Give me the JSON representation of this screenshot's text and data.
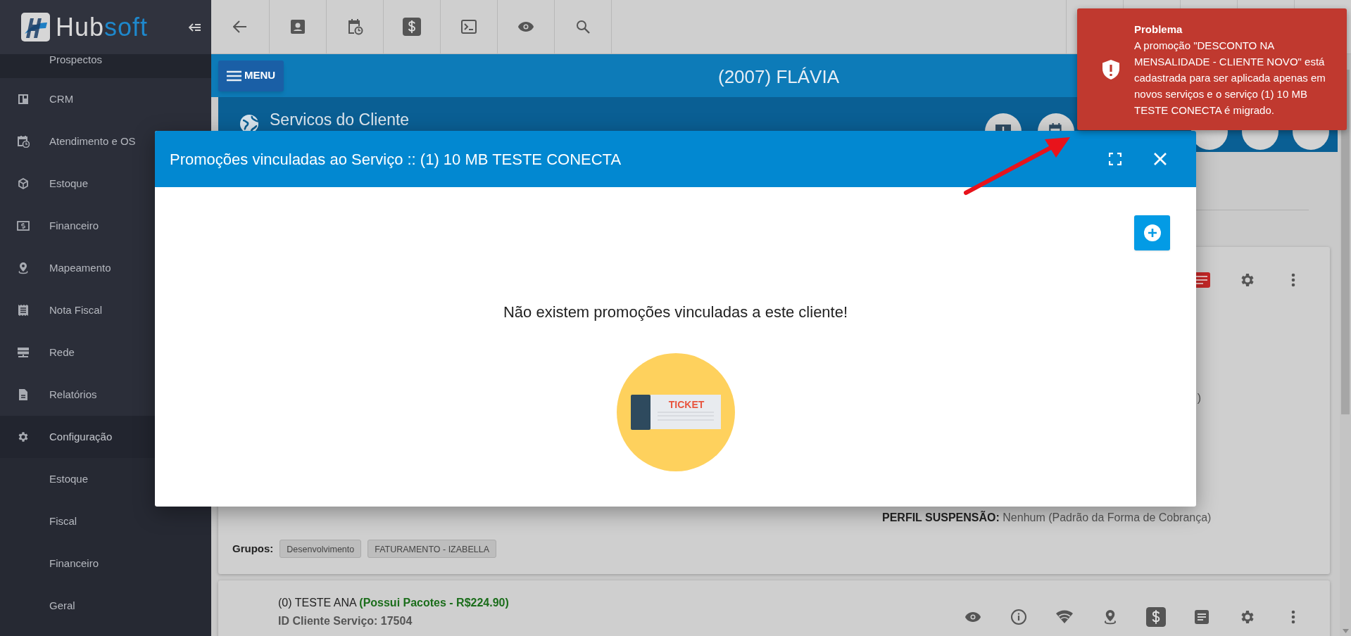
{
  "sidebar": {
    "brand": {
      "first": "Hub",
      "second": "soft"
    },
    "items": [
      {
        "label": "Prospectos",
        "kind": "subitem"
      },
      {
        "label": "CRM",
        "kind": "item"
      },
      {
        "label": "Atendimento e OS",
        "kind": "item"
      },
      {
        "label": "Estoque",
        "kind": "item"
      },
      {
        "label": "Financeiro",
        "kind": "item"
      },
      {
        "label": "Mapeamento",
        "kind": "item"
      },
      {
        "label": "Nota Fiscal",
        "kind": "item"
      },
      {
        "label": "Rede",
        "kind": "item"
      },
      {
        "label": "Relatórios",
        "kind": "item"
      },
      {
        "label": "Configuração",
        "kind": "item",
        "expanded": true,
        "children": [
          {
            "label": "Estoque"
          },
          {
            "label": "Fiscal"
          },
          {
            "label": "Financeiro"
          },
          {
            "label": "Geral"
          }
        ]
      }
    ]
  },
  "header": {
    "menu_button": "MENU",
    "client_title": "(2007) FLÁVIA"
  },
  "section": {
    "title": "Servicos do Cliente"
  },
  "services": [
    {
      "fragment": ")",
      "details": [
        {
          "label": "PERFIL SUSPENSÃO:",
          "value": "Nenhum (Padrão da Forma de Cobrança)"
        }
      ],
      "groups_label": "Grupos:",
      "groups": [
        "Desenvolvimento",
        "FATURAMENTO - IZABELLA"
      ]
    },
    {
      "name": "(0) TESTE ANA",
      "note": "(Possui Pacotes - R$224.90)",
      "id_text": "ID Cliente Serviço: 17504"
    }
  ],
  "modal": {
    "title": "Promoções vinculadas ao Serviço :: (1) 10 MB TESTE CONECTA",
    "empty_message": "Não existem promoções vinculadas a este cliente!",
    "illustration_label": "TICKET"
  },
  "notification": {
    "title": "Problema",
    "message": "A promoção \"DESCONTO NA MENSALIDADE - CLIENTE NOVO\" está cadastrada para ser aplicada apenas em novos serviços e o serviço (1) 10 MB TESTE CONECTA é migrado."
  }
}
